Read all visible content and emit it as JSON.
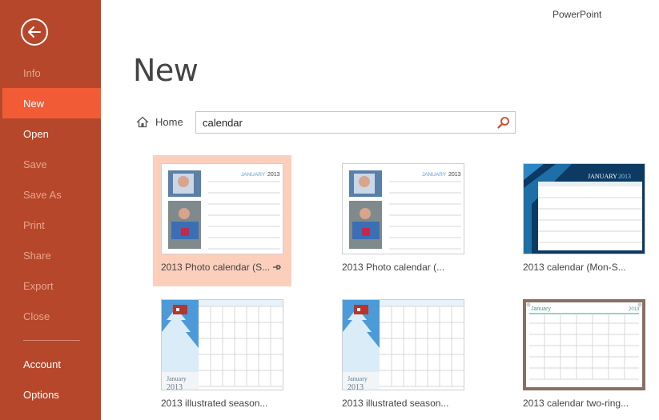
{
  "app": {
    "name": "PowerPoint"
  },
  "page": {
    "title": "New"
  },
  "nav": {
    "items": [
      {
        "label": "Info",
        "state": "disabled"
      },
      {
        "label": "New",
        "state": "active"
      },
      {
        "label": "Open",
        "state": "enabled"
      },
      {
        "label": "Save",
        "state": "disabled"
      },
      {
        "label": "Save As",
        "state": "disabled"
      },
      {
        "label": "Print",
        "state": "disabled"
      },
      {
        "label": "Share",
        "state": "disabled"
      },
      {
        "label": "Export",
        "state": "disabled"
      },
      {
        "label": "Close",
        "state": "disabled"
      },
      {
        "label": "Account",
        "state": "enabled"
      },
      {
        "label": "Options",
        "state": "enabled"
      }
    ]
  },
  "home": {
    "label": "Home"
  },
  "search": {
    "value": "calendar"
  },
  "templates": [
    {
      "label": "2013 Photo calendar (S...",
      "thumb_month": "JANUARY",
      "thumb_year": "2013",
      "selected": true,
      "pinned": true
    },
    {
      "label": "2013 Photo calendar (...",
      "thumb_month": "JANUARY",
      "thumb_year": "2013"
    },
    {
      "label": "2013 calendar (Mon-S...",
      "thumb_month": "JANUARY",
      "thumb_year": "2013"
    },
    {
      "label": "2013 illustrated season...",
      "thumb_month": "January",
      "thumb_year": "2013"
    },
    {
      "label": "2013 illustrated season...",
      "thumb_month": "January",
      "thumb_year": "2013"
    },
    {
      "label": "2013 calendar two-ring...",
      "thumb_month": "January",
      "thumb_year": "2013"
    }
  ],
  "colors": {
    "sidebar": "#b7472a",
    "active_nav": "#f15c37",
    "selected_tile": "#fccfbd"
  }
}
